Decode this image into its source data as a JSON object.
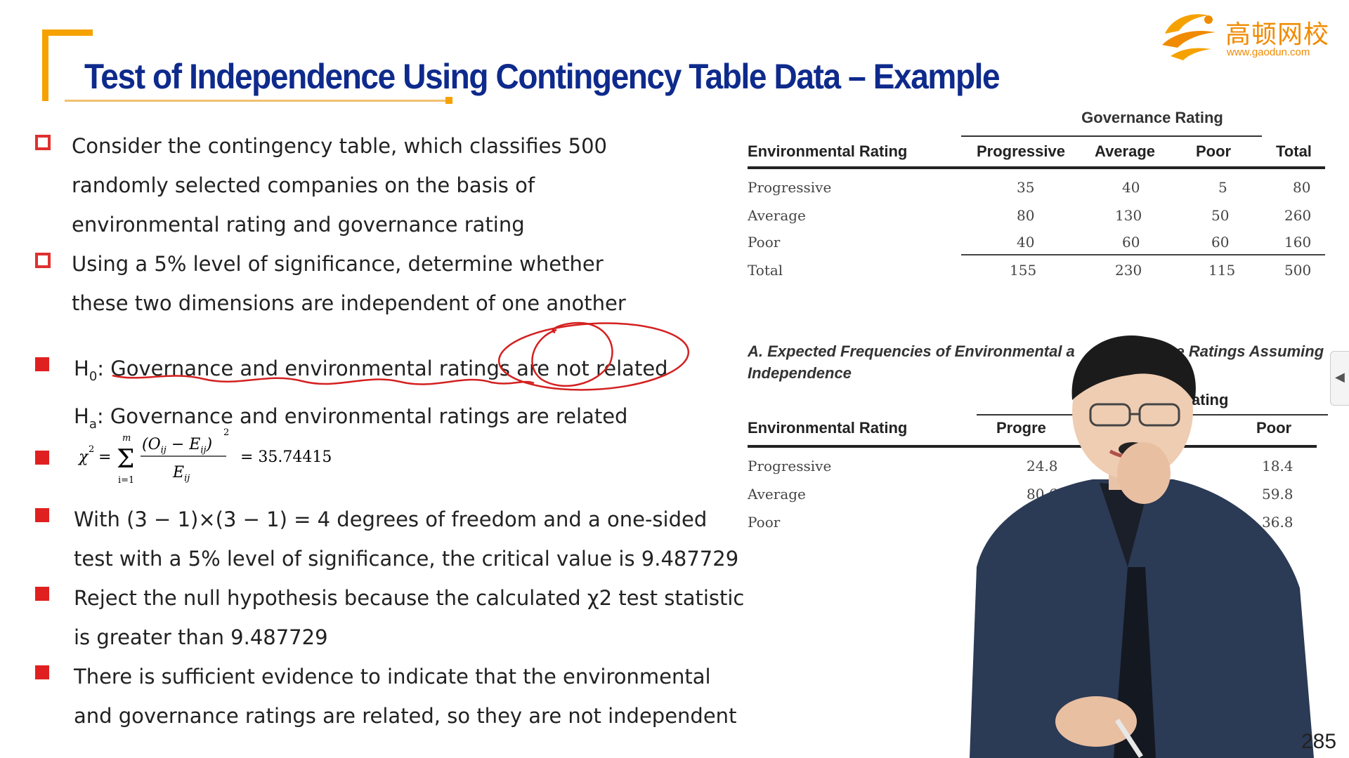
{
  "slide": {
    "title": "Test of Independence Using Contingency Table Data – Example",
    "page_number": "285"
  },
  "logo": {
    "text": "高顿网校",
    "url": "www.gaodun.com"
  },
  "bullets": {
    "b1": [
      "Consider the contingency table, which classifies 500",
      "randomly selected companies on the basis of",
      "environmental rating and governance rating"
    ],
    "b2": [
      "Using a 5% level of significance, determine whether",
      "these two dimensions are independent of one another"
    ],
    "h0_label": "H",
    "h0_sub": "0",
    "h0_text": ": Governance and environmental ratings are not related",
    "ha_label": "H",
    "ha_sub": "a",
    "ha_text": ": Governance and environmental ratings are related",
    "formula": {
      "lhs": "χ",
      "exp": "2",
      "eq": "=",
      "sum_top": "m",
      "sum_bottom": "i=1",
      "numerator": "(O",
      "numerator_sub": "ij",
      "minus": " − E",
      "minus_sub": "ij",
      "denominator": "E",
      "denominator_sub": "ij",
      "power": "2",
      "result": "= 35.74415"
    },
    "b4": [
      "With (3 − 1)×(3 − 1) = 4 degrees of freedom and a one-sided",
      "test with a 5% level of significance, the critical value is 9.487729"
    ],
    "b5": [
      "Reject the null hypothesis because the calculated χ2 test statistic",
      "is greater than 9.487729"
    ],
    "b6": [
      "There is sufficient evidence to indicate that the environmental",
      "and governance ratings are related, so they are not independent"
    ]
  },
  "table1": {
    "group_header": "Governance Rating",
    "headers": [
      "Environmental Rating",
      "Progressive",
      "Average",
      "Poor",
      "Total"
    ],
    "rows": [
      [
        "Progressive",
        "35",
        "40",
        "5",
        "80"
      ],
      [
        "Average",
        "80",
        "130",
        "50",
        "260"
      ],
      [
        "Poor",
        "40",
        "60",
        "60",
        "160"
      ],
      [
        "Total",
        "155",
        "230",
        "115",
        "500"
      ]
    ]
  },
  "table2": {
    "caption_a": "A. Expected Frequencies of Environmental a",
    "caption_b": "nce Ratings Assuming",
    "caption_c": "Independence",
    "group_header_visible": "Rating",
    "headers": [
      "Environmental Rating",
      "Progre",
      "e",
      "Poor"
    ],
    "rows": [
      [
        "Progressive",
        "24.8",
        "18.4"
      ],
      [
        "Average",
        "80.6",
        "59.8"
      ],
      [
        "Poor",
        "",
        "36.8"
      ]
    ]
  },
  "colors": {
    "title": "#0e2a8c",
    "accent_orange": "#f5a200",
    "bullet_red": "#e02020",
    "ink_red": "#d42020"
  }
}
